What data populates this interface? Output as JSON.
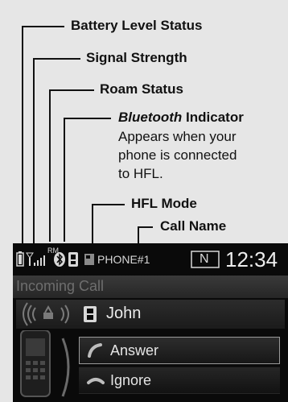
{
  "callouts": {
    "battery": "Battery Level Status",
    "signal": "Signal Strength",
    "roam": "Roam Status",
    "bluetooth_italic": "Bluetooth",
    "bluetooth_rest": " Indicator",
    "bluetooth_desc": [
      "Appears when your",
      "phone is connected",
      "to HFL."
    ],
    "hfl_mode": "HFL Mode",
    "call_name": "Call Name"
  },
  "status_bar": {
    "roam_indicator": "RM",
    "phone_name": "PHONE#1",
    "mode_badge": "N",
    "time": "12:34"
  },
  "call": {
    "header": "Incoming Call",
    "caller": "John",
    "answer_label": "Answer",
    "ignore_label": "Ignore"
  },
  "colors": {
    "screen_bg": "#0a0a0a",
    "callout_bg": "#e6e6e6",
    "text_light": "#e4e4e4"
  },
  "icons": [
    "battery-icon",
    "signal-icon",
    "bluetooth-icon",
    "hfl-mode-icon",
    "contact-card-icon",
    "phone-handset-icon",
    "answer-icon",
    "ignore-icon"
  ]
}
